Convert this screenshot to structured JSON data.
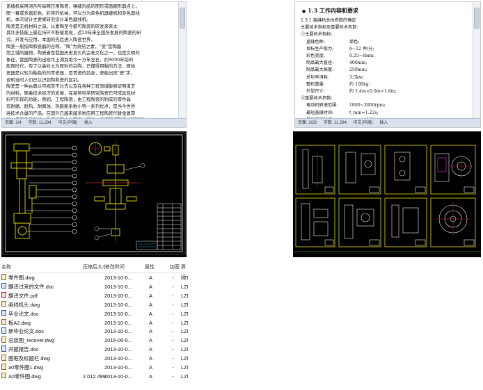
{
  "doc_left": {
    "lines": [
      "盖缝机采用溶剂与每两日用陶瓷，镜缝剂品的图形或画圈形器点上，",
      "图一幕或多器彩色，彩带的机械，可以分为单色机器缝机和多色器线",
      "机，本次设计主要果研究设计单色器线机。",
      "    陶瓷是无机材料之母。从素陶至今都可陶瓷的研发来来太",
      "其许多技能上最在持环不断被发现，近20年来全国所发展的陶瓷的研",
      "究、开发与应用，本国的先后进入陶瓷世界，",
      "    陶瓷一般指陶和瓷器的合称，\"陶\"为烧结之素，\"瓷\"是陶器",
      "而之城的器物，陶瓷者是我国历史发久的古老文化之一，也是文明的",
      "象征，我国陶瓷的出现可上溯到距今一万年左右，约9000年前的",
      "般周时代，有了以高岭土为原料的白陶，已懂得用釉的方法，原始",
      "瓷器是以较为釉色的的青瓷器，是青瓷的前身，瓷能出现\"瓷\"字，",
      "说明当时人们已认识到陶和瓷的区别。",
      "    陶瓷是一种古典以可视定不过去以及在各种工程领域能够证明道艺",
      "的材料，随着技术经济的发展，在某些科学研究陶瓷已可成具包材",
      "料可实现的功能，例如，工程陶瓷，由工程陶瓷的制成的零件具",
      "有耐磨、耐热、耐腐蚀、热膨胀系数小等一系列优点，是当今世界",
      "高技术含量的产品。在国外已越来越多地应用工程陶瓷代替金属零",
      "件，使产品性能好，稳定性等大大提高。在加，收盛镜描陶瓷（LTCC）",
      "大是一定远影以陶瓷手机行业应用起步时的时代的作一一大发大，它",
      "又是又是，偶年不方便，而现在的手机则都是能轻划了，这是因为机",
      "随性是 LTCC 技术的发展。LTCC 技术是把所有不同的元件都集合在一起，",
      "表金特为\"低温共烧陶瓷\"技术，简单地说，就是一种整合一个型",
      "化继合元件在多种功能组件整合在一起，是价格最高技术的的由一日，"
    ],
    "status": [
      "页面: 2/4",
      "字数: 11,294",
      "中文(中国)",
      "插入"
    ]
  },
  "doc_right": {
    "section_title": "1.3  工作内容和要求",
    "lines_top": [
      "1.3.1  盖缝机总体参数的确定",
      "主要技术指标及重要技术参数:",
      "①主要技术指标:"
    ],
    "specs1": [
      {
        "k": "盖缝色种:",
        "v": "单色;"
      },
      {
        "k": "台标生产能力:",
        "v": "6~12 件/分;"
      },
      {
        "k": "彩色宽度:",
        "v": "0.25~6mm;"
      },
      {
        "k": "制品最大直径:",
        "v": "400mm;"
      },
      {
        "k": "制品最大高度:",
        "v": "250mm;"
      },
      {
        "k": "总功率消耗:",
        "v": "3.5kw;"
      },
      {
        "k": "整机重量:",
        "v": "约 100kg;"
      },
      {
        "k": "外型尺寸:",
        "v": "约 1.4m×0.9m×1.6m;"
      }
    ],
    "heading2": "②重要技术参数:",
    "specs2": [
      {
        "k": "电动机转速范围:",
        "v": "1000~3000rpm;"
      },
      {
        "k": "最短盖缝时间:",
        "v": "t_min=1.22s;"
      },
      {
        "k": "最长盖缝时间:",
        "v": "t_max=4.14s;"
      },
      {
        "k": "盖缝辅助时间:",
        "v": "t=3s;"
      }
    ],
    "status": [
      "页面: 2/28",
      "字数: 11,294",
      "中文(中国)",
      "插入"
    ]
  },
  "cad_colors": {
    "background": "#000000",
    "yellow": "#e8e000",
    "white": "#f2f2f2",
    "cyan": "#19d6e6",
    "magenta": "#e040e0",
    "red": "#ff3030",
    "green": "#30d050"
  },
  "file_list": {
    "headers": [
      "名称",
      "压缩后大小",
      "修改时间",
      "属性",
      "加密",
      "算法"
    ],
    "rows": [
      {
        "name": "零件图.dwg",
        "size": "",
        "date": "2013-10-0...",
        "attr": "A",
        "crypt": "-",
        "algo": "LZM",
        "icon": "dwg"
      },
      {
        "name": "翻译过来的文件.doc",
        "size": "",
        "date": "2013-10-0...",
        "attr": "A",
        "crypt": "-",
        "algo": "LZM",
        "icon": "doc"
      },
      {
        "name": "翻译文件.pdf",
        "size": "",
        "date": "2013-10-0...",
        "attr": "A",
        "crypt": "-",
        "algo": "LZM",
        "icon": "pdf"
      },
      {
        "name": "画线机头.dwg",
        "size": "",
        "date": "2013-10-0...",
        "attr": "A",
        "crypt": "-",
        "algo": "LZM",
        "icon": "dwg"
      },
      {
        "name": "毕业论文.doc",
        "size": "",
        "date": "2013-10-0...",
        "attr": "A",
        "crypt": "-",
        "algo": "LZM",
        "icon": "doc"
      },
      {
        "name": "板A2.dwg",
        "size": "",
        "date": "2013-10-0...",
        "attr": "A",
        "crypt": "-",
        "algo": "LZM",
        "icon": "dwg"
      },
      {
        "name": "新毕业论文.doc",
        "size": "",
        "date": "2013-10-0...",
        "attr": "A",
        "crypt": "-",
        "algo": "LZM",
        "icon": "doc"
      },
      {
        "name": "总装图_recover.dwg",
        "size": "",
        "date": "2016-06-0...",
        "attr": "A",
        "crypt": "-",
        "algo": "LZM",
        "icon": "dwg"
      },
      {
        "name": "开题报告.doc",
        "size": "",
        "date": "2013-10-0...",
        "attr": "A",
        "crypt": "-",
        "algo": "LZM",
        "icon": "doc"
      },
      {
        "name": "图框及标题栏.dwg",
        "size": "",
        "date": "2013-10-0...",
        "attr": "A",
        "crypt": "-",
        "algo": "LZM",
        "icon": "dwg"
      },
      {
        "name": "a0零件图1.dwg",
        "size": "",
        "date": "2013-10-0...",
        "attr": "A",
        "crypt": "-",
        "algo": "LZM",
        "icon": "dwg"
      },
      {
        "name": "A0零件图.dwg",
        "size": "2 012 499",
        "date": "2013-10-0...",
        "attr": "A",
        "crypt": "-",
        "algo": "LZM",
        "icon": "dwg"
      }
    ]
  }
}
